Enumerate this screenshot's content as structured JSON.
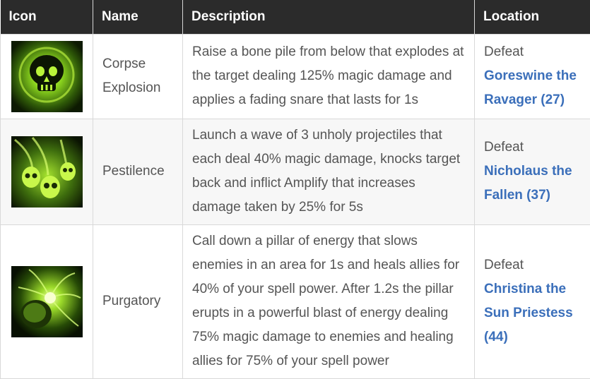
{
  "headers": {
    "icon": "Icon",
    "name": "Name",
    "description": "Description",
    "location": "Location"
  },
  "rows": [
    {
      "icon": "skull-explosion-icon",
      "name": "Corpse Explosion",
      "description": "Raise a bone pile from below that explodes at the target dealing 125% magic damage and applies a fading snare that lasts for 1s",
      "location_prefix": "Defeat",
      "location_link": "Goreswine the Ravager (27)"
    },
    {
      "icon": "ghost-skulls-icon",
      "name": "Pestilence",
      "description": "Launch a wave of 3 unholy projectiles that each deal 40% magic damage, knocks target back and inflict Amplify that increases damage taken by 25% for 5s",
      "location_prefix": "Defeat",
      "location_link": "Nicholaus the Fallen (37)"
    },
    {
      "icon": "energy-pillar-icon",
      "name": "Purgatory",
      "description": "Call down a pillar of energy that slows enemies in an area for 1s and heals allies for 40% of your spell power. After 1.2s the pillar erupts in a powerful blast of energy dealing 75% magic damage to enemies and healing allies for 75% of your spell power",
      "location_prefix": "Defeat",
      "location_link": "Christina the Sun Priestess (44)"
    }
  ],
  "colors": {
    "header_bg": "#2b2b2b",
    "link": "#3b6fba",
    "text": "#555555",
    "icon_green": "#9be22a"
  }
}
